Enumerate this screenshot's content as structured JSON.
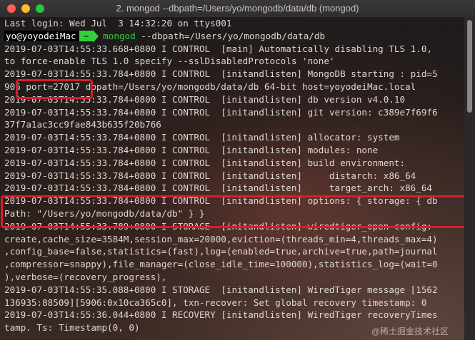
{
  "window": {
    "title": "2. mongod --dbpath=/Users/yo/mongodb/data/db (mongod)"
  },
  "terminal": {
    "last_login": "Last login: Wed Jul  3 14:32:20 on ttys001",
    "prompt_user": "yo@yoyodeiMac",
    "prompt_dir": "~",
    "command": "mongod",
    "command_args": " --dbpath=/Users/yo/mongodb/data/db",
    "lines": [
      "2019-07-03T14:55:33.668+0800 I CONTROL  [main] Automatically disabling TLS 1.0,",
      "to force-enable TLS 1.0 specify --sslDisabledProtocols 'none'",
      "2019-07-03T14:55:33.784+0800 I CONTROL  [initandlisten] MongoDB starting : pid=5",
      "906 port=27017 dbpath=/Users/yo/mongodb/data/db 64-bit host=yoyodeiMac.local",
      "2019-07-03T14:55:33.784+0800 I CONTROL  [initandlisten] db version v4.0.10",
      "2019-07-03T14:55:33.784+0800 I CONTROL  [initandlisten] git version: c389e7f69f6",
      "37f7a1ac3cc9fae843b635f20b766",
      "2019-07-03T14:55:33.784+0800 I CONTROL  [initandlisten] allocator: system",
      "2019-07-03T14:55:33.784+0800 I CONTROL  [initandlisten] modules: none",
      "2019-07-03T14:55:33.784+0800 I CONTROL  [initandlisten] build environment:",
      "2019-07-03T14:55:33.784+0800 I CONTROL  [initandlisten]     distarch: x86_64",
      "2019-07-03T14:55:33.784+0800 I CONTROL  [initandlisten]     target_arch: x86_64",
      "2019-07-03T14:55:33.784+0800 I CONTROL  [initandlisten] options: { storage: { db",
      "Path: \"/Users/yo/mongodb/data/db\" } }",
      "2019-07-03T14:55:33.789+0800 I STORAGE  [initandlisten] wiredtiger_open config:",
      "create,cache_size=3584M,session_max=20000,eviction=(threads_min=4,threads_max=4)",
      ",config_base=false,statistics=(fast),log=(enabled=true,archive=true,path=journal",
      ",compressor=snappy),file_manager=(close_idle_time=100000),statistics_log=(wait=0",
      "),verbose=(recovery_progress),",
      "2019-07-03T14:55:35.088+0800 I STORAGE  [initandlisten] WiredTiger message [1562",
      "136935:88509][5906:0x10ca365c0], txn-recover: Set global recovery timestamp: 0",
      "2019-07-03T14:55:36.044+0800 I RECOVERY [initandlisten] WiredTiger recoveryTimes",
      "tamp. Ts: Timestamp(0, 0)"
    ]
  },
  "watermark": "@稀土掘金技术社区",
  "colors": {
    "highlight_box": "#d91d2b",
    "prompt_green": "#2fd13a"
  }
}
